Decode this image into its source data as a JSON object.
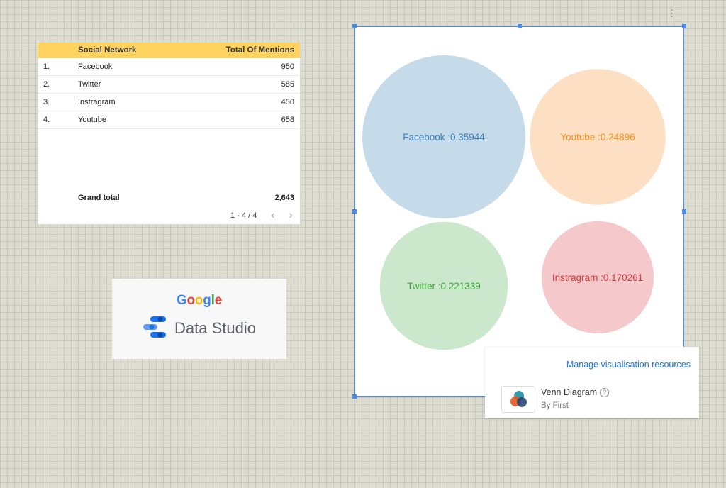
{
  "table": {
    "headers": {
      "name": "Social Network",
      "value": "Total Of Mentions"
    },
    "rows": [
      {
        "index": "1.",
        "name": "Facebook",
        "value": "950"
      },
      {
        "index": "2.",
        "name": "Twitter",
        "value": "585"
      },
      {
        "index": "3.",
        "name": "Instragram",
        "value": "450"
      },
      {
        "index": "4.",
        "name": "Youtube",
        "value": "658"
      }
    ],
    "grand_total_label": "Grand total",
    "grand_total_value": "2,643",
    "pagination": "1 - 4 / 4",
    "prev_icon": "chevron-left-icon",
    "next_icon": "chevron-right-icon",
    "header_color": "#fdd25e"
  },
  "logo": {
    "google_letters": [
      {
        "ch": "G",
        "color": "#4285f4"
      },
      {
        "ch": "o",
        "color": "#ea4335"
      },
      {
        "ch": "o",
        "color": "#fbbc05"
      },
      {
        "ch": "g",
        "color": "#4285f4"
      },
      {
        "ch": "l",
        "color": "#34a853"
      },
      {
        "ch": "e",
        "color": "#ea4335"
      }
    ],
    "product": "Data Studio"
  },
  "chart_data": {
    "type": "venn",
    "sets": [
      {
        "label": "Facebook :0.35944",
        "value": 0.35944,
        "fill": "#c6dbea",
        "text_color": "#3d7fb8"
      },
      {
        "label": "Youtube :0.24896",
        "value": 0.24896,
        "fill": "#fde0c4",
        "text_color": "#ff8a1a"
      },
      {
        "label": "Twitter :0.221339",
        "value": 0.221339,
        "fill": "#cce8cc",
        "text_color": "#3aa53a"
      },
      {
        "label": "Instragram :0.170261",
        "value": 0.170261,
        "fill": "#f5c9cb",
        "text_color": "#d83a3c"
      }
    ]
  },
  "resources": {
    "manage_link": "Manage visualisation resources",
    "viz_name": "Venn Diagram",
    "viz_author": "By First",
    "help_icon": "help-circle-icon",
    "accent": "#1a73e8"
  },
  "menu_icon": "kebab-menu-icon"
}
